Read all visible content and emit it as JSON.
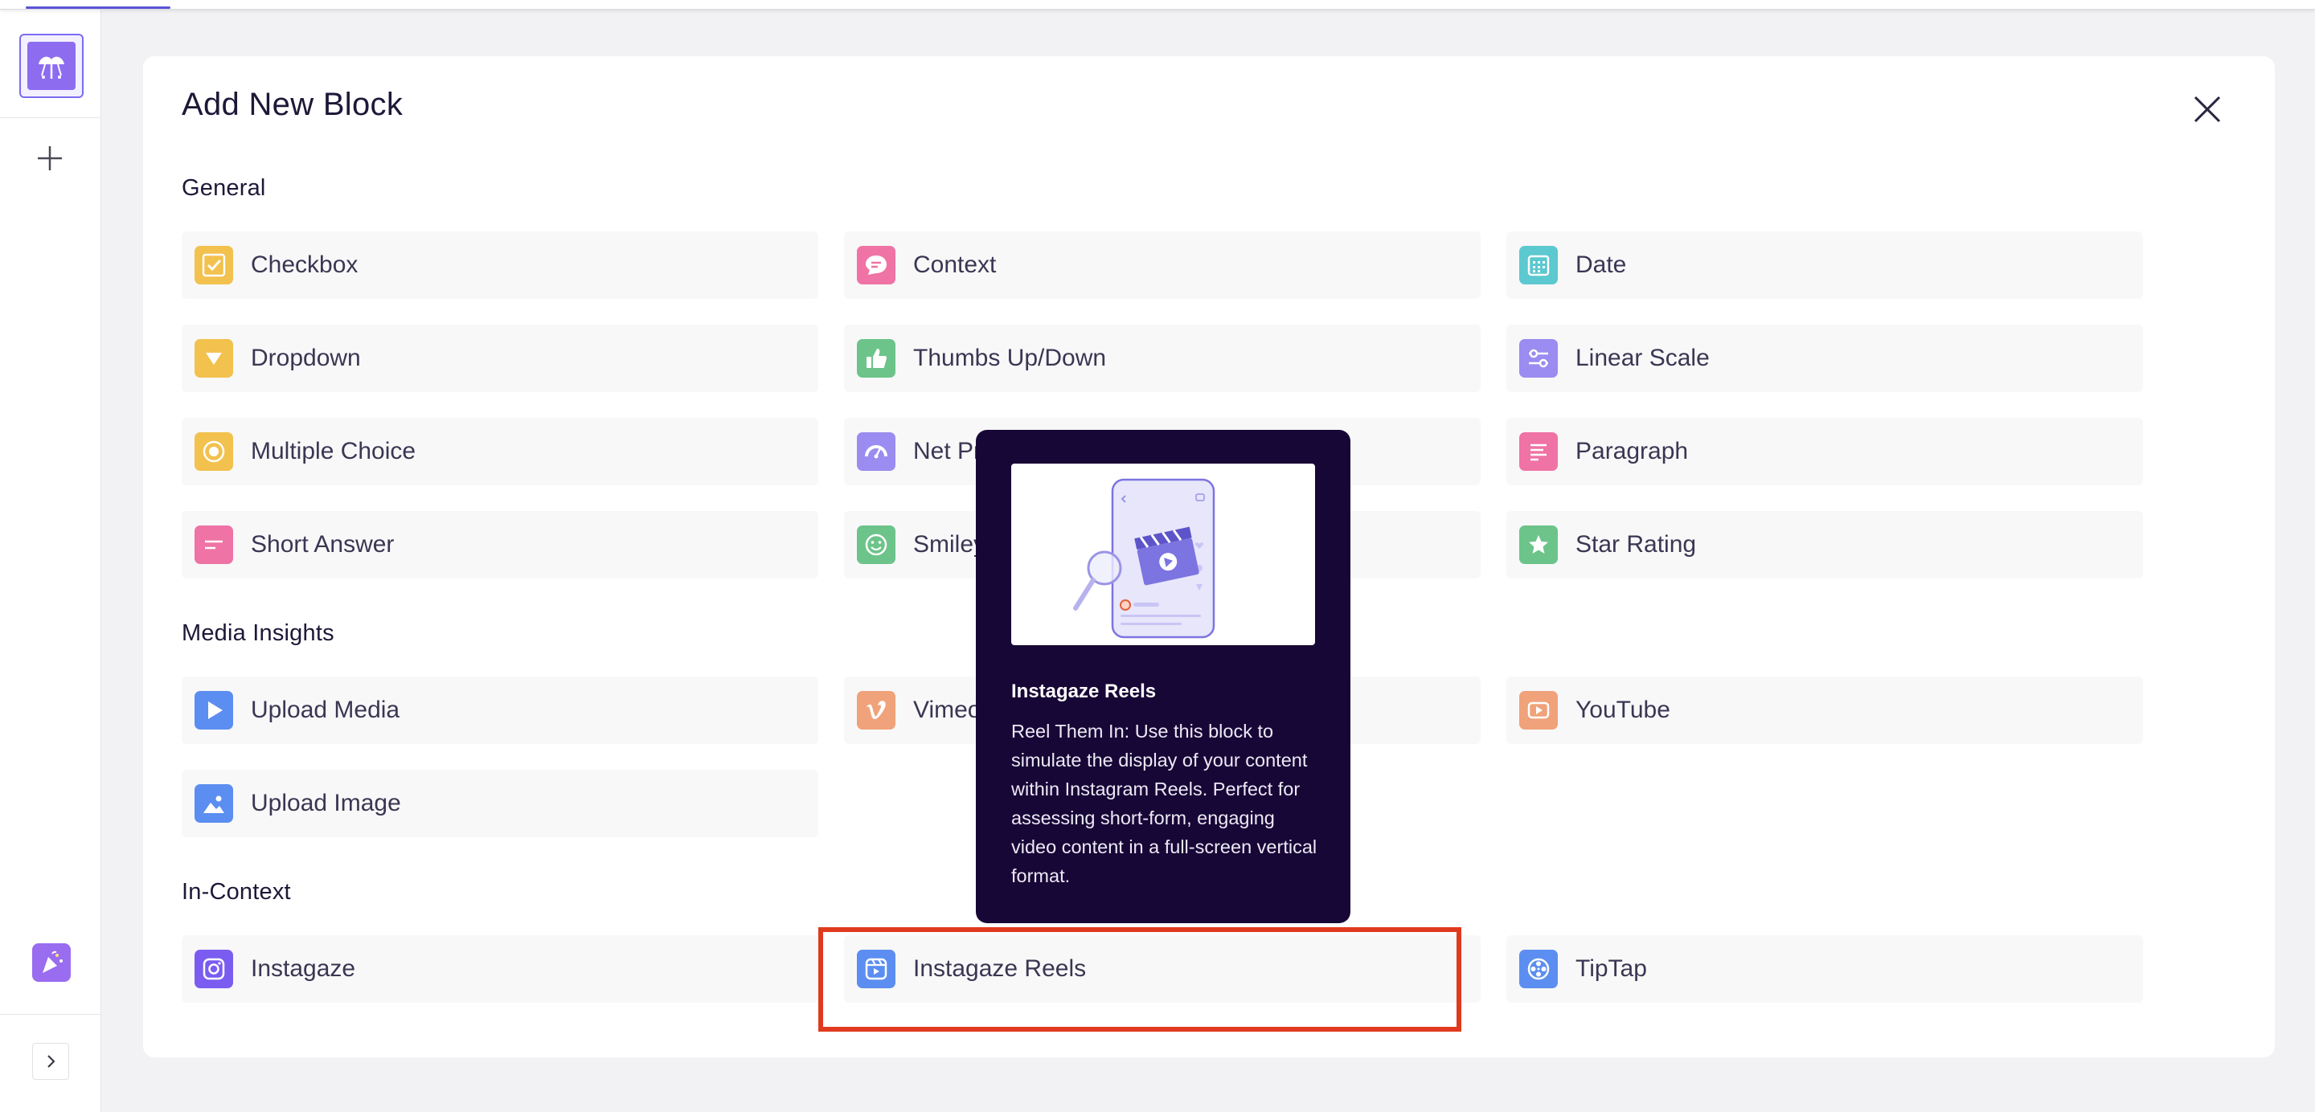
{
  "app": {
    "rail": {
      "logo_icon": "app-logo-icon",
      "add_icon": "plus-icon",
      "party_icon": "party-popper-icon",
      "expand_icon": "chevron-right-icon"
    }
  },
  "modal": {
    "title": "Add New Block",
    "close_icon": "close-icon",
    "sections": {
      "general": {
        "title": "General",
        "items": [
          {
            "label": "Checkbox",
            "icon": "checkbox-icon",
            "color": "#f2c14e"
          },
          {
            "label": "Context",
            "icon": "chat-bubble-icon",
            "color": "#ef73a4"
          },
          {
            "label": "Date",
            "icon": "calendar-icon",
            "color": "#5cc8cf"
          },
          {
            "label": "Dropdown",
            "icon": "dropdown-triangle-icon",
            "color": "#f2c14e"
          },
          {
            "label": "Thumbs Up/Down",
            "icon": "thumbs-up-icon",
            "color": "#6cc48a"
          },
          {
            "label": "Linear Scale",
            "icon": "sliders-icon",
            "color": "#9a8cf0"
          },
          {
            "label": "Multiple Choice",
            "icon": "radio-icon",
            "color": "#f2c14e"
          },
          {
            "label": "Net Pr",
            "icon": "gauge-icon",
            "color": "#9a8cf0"
          },
          {
            "label": "Paragraph",
            "icon": "paragraph-lines-icon",
            "color": "#ef73a4"
          },
          {
            "label": "Short Answer",
            "icon": "short-lines-icon",
            "color": "#ef73a4"
          },
          {
            "label": "Smiley",
            "icon": "smiley-icon",
            "color": "#6cc48a"
          },
          {
            "label": "Star Rating",
            "icon": "star-icon",
            "color": "#6cc48a"
          }
        ]
      },
      "media": {
        "title": "Media Insights",
        "items": [
          {
            "label": "Upload Media",
            "icon": "play-icon",
            "color": "#5b8ef0"
          },
          {
            "label": "Vimeo",
            "icon": "vimeo-icon",
            "color": "#f0a27a"
          },
          {
            "label": "YouTube",
            "icon": "youtube-icon",
            "color": "#f0a27a"
          },
          {
            "label": "Upload Image",
            "icon": "image-icon",
            "color": "#5b8ef0"
          }
        ]
      },
      "incontext": {
        "title": "In-Context",
        "items": [
          {
            "label": "Instagaze",
            "icon": "instagram-icon",
            "color": "#7b5cf0"
          },
          {
            "label": "Instagaze Reels",
            "icon": "reels-icon",
            "color": "#5b8ef0"
          },
          {
            "label": "TipTap",
            "icon": "film-reel-icon",
            "color": "#5b8ef0"
          }
        ]
      }
    }
  },
  "tooltip": {
    "title": "Instagaze Reels",
    "description": "Reel Them In: Use this block to simulate the display of your content within Instagram Reels. Perfect for assessing short-form, engaging video content in a full-screen vertical format.",
    "illustration_icon": "phone-reels-illustration"
  },
  "highlight": {
    "color": "#e03a1e",
    "target": "Instagaze Reels"
  }
}
